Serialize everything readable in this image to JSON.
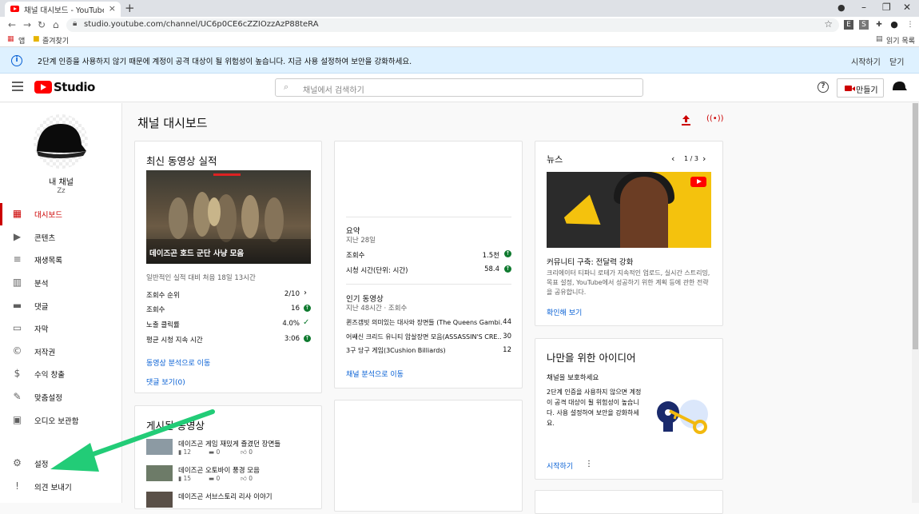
{
  "browser": {
    "tab_title": "채널 대시보드 - YouTube Studio",
    "new_tab": "+",
    "url": "studio.youtube.com/channel/UC6p0CE6cZZIOzzAzP88teRA",
    "bookmarks": {
      "apps": "앱",
      "favorites": "즐겨찾기",
      "reading_list": "읽기 목록"
    }
  },
  "notice": {
    "info": "i",
    "message": "2단계 인증을 사용하지 않기 때문에 계정이 공격 대상이 될 위험성이 높습니다. 지금 사용 설정하여 보안을 강화하세요.",
    "start": "시작하기",
    "close": "닫기"
  },
  "header": {
    "logo_text": "Studio",
    "search_placeholder": "채널에서 검색하기",
    "help": "?",
    "create": "만들기"
  },
  "sidebar": {
    "channel_name": "내 채널",
    "channel_sub": "Zz",
    "items": [
      {
        "label": "대시보드",
        "icon": "dashboard-icon"
      },
      {
        "label": "콘텐츠",
        "icon": "content-icon"
      },
      {
        "label": "재생목록",
        "icon": "playlist-icon"
      },
      {
        "label": "분석",
        "icon": "analytics-icon"
      },
      {
        "label": "댓글",
        "icon": "comments-icon"
      },
      {
        "label": "자막",
        "icon": "subtitles-icon"
      },
      {
        "label": "저작권",
        "icon": "copyright-icon"
      },
      {
        "label": "수익 창출",
        "icon": "dollar-icon"
      },
      {
        "label": "맞춤설정",
        "icon": "wand-icon"
      },
      {
        "label": "오디오 보관함",
        "icon": "audio-library-icon"
      }
    ],
    "settings": "설정",
    "feedback": "의견 보내기"
  },
  "page": {
    "title": "채널 대시보드"
  },
  "latest": {
    "title": "최신 동영상 실적",
    "thumb_caption": "데이즈곤 호드 군단 사냥 모음",
    "subtitle": "일반적인 실적 대비 처음 18일 13시간",
    "rows": [
      {
        "label": "조회수 순위",
        "value": "2/10"
      },
      {
        "label": "조회수",
        "value": "16"
      },
      {
        "label": "노출 클릭률",
        "value": "4.0%"
      },
      {
        "label": "평균 시청 지속 시간",
        "value": "3:06"
      }
    ],
    "analytics_link": "동영상 분석으로 이동",
    "comments_link": "댓글 보기(0)"
  },
  "analytics": {
    "summary_title": "요약",
    "summary_sub": "지난 28일",
    "rows": [
      {
        "label": "조회수",
        "value": "1.5천"
      },
      {
        "label": "시청 시간(단위: 시간)",
        "value": "58.4"
      }
    ],
    "top_title": "인기 동영상",
    "top_sub": "지난 48시간 · 조회수",
    "top": [
      {
        "label": "퀸즈갬빗 의미있는 대사와 장면들 (The Queens Gambi...",
        "value": "44"
      },
      {
        "label": "어쌔신 크리드 유니티 암살장면 모음(ASSASSIN'S CRE...",
        "value": "30"
      },
      {
        "label": "3구 당구 게임(3Cushion Billiards)",
        "value": "12"
      }
    ],
    "link": "채널 분석으로 이동"
  },
  "published": {
    "title": "게시된 동영상",
    "videos": [
      {
        "title": "데이즈곤 게임 재밌게 즐겼던 장면들",
        "views": "12",
        "comments": "0",
        "likes": "0"
      },
      {
        "title": "데이즈곤 오토바이 풍경 모음",
        "views": "15",
        "comments": "0",
        "likes": "0"
      },
      {
        "title": "데이즈곤 서브스토리 리사 이야기",
        "views": "",
        "comments": "",
        "likes": ""
      }
    ]
  },
  "news": {
    "title": "뉴스",
    "pager": "1 / 3",
    "headline": "커뮤니티 구축: 전달력 강화",
    "body": "크리에이터 티파니 로테가 지속적인 업로드, 실시간 스트리밍, 목표 설정, YouTube에서 성공하기 위한 계획 등에 관한 전략을 공유합니다.",
    "link": "확인해 보기"
  },
  "ideas": {
    "title": "나만을 위한 아이디어",
    "subtitle": "채널을 보호하세요",
    "body": "2단계 인증을 사용하지 않으면 계정이 공격 대상이 될 위험성이 높습니다. 사용 설정하여 보안을 강화하세요.",
    "start": "시작하기"
  },
  "colors": {
    "accent": "#cc0000",
    "link": "#065fd4",
    "arrow": "#22cc77"
  }
}
